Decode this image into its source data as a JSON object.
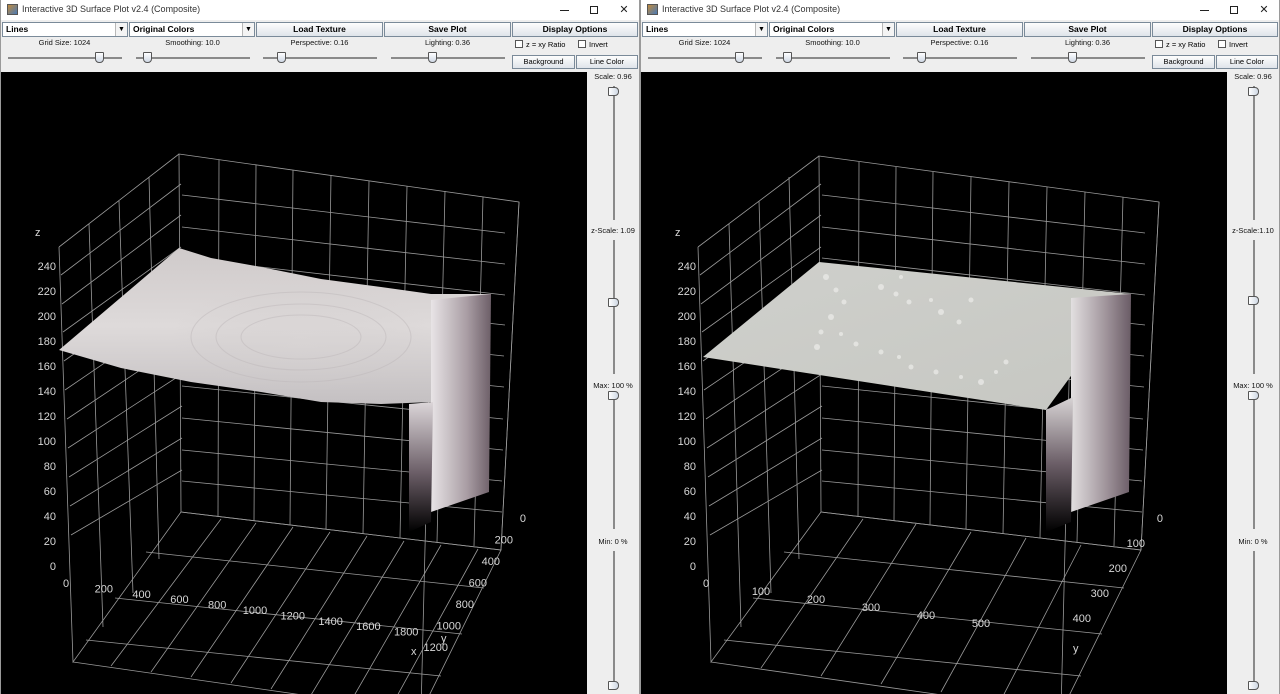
{
  "windows": [
    {
      "title": "Interactive 3D Surface Plot v2.4  (Composite)",
      "style_select": "Lines",
      "color_select": "Original Colors",
      "load_texture": "Load Texture",
      "save_plot": "Save Plot",
      "display_options": "Display Options",
      "grid_size": "Grid Size: 1024",
      "smoothing": "Smoothing: 10.0",
      "perspective": "Perspective: 0.16",
      "lighting": "Lighting: 0.36",
      "z_xy_ratio": "z = xy Ratio",
      "invert": "Invert",
      "background": "Background",
      "line_color": "Line Color",
      "scale": "Scale: 0.96",
      "z_scale": "z-Scale: 1.09",
      "max": "Max: 100 %",
      "min": "Min: 0 %",
      "axis_z": "z",
      "axis_x": "x",
      "axis_y": "y",
      "z_ticks": [
        "0",
        "20",
        "40",
        "60",
        "80",
        "100",
        "120",
        "140",
        "160",
        "180",
        "200",
        "220",
        "240"
      ],
      "x_ticks": [
        "0",
        "200",
        "400",
        "600",
        "800",
        "1000",
        "1200",
        "1400",
        "1600",
        "1800"
      ],
      "y_ticks": [
        "0",
        "200",
        "400",
        "600",
        "800",
        "1000",
        "1200"
      ],
      "sliders": {
        "grid_size": 0.8,
        "smoothing": 0.1,
        "perspective": 0.16,
        "lighting": 0.36
      },
      "vsliders": {
        "scale": 0.96,
        "z_scale": 0.54,
        "max": 1.0,
        "min": 0.0
      },
      "surface_shape": "dish"
    },
    {
      "title": "Interactive 3D Surface Plot v2.4  (Composite)",
      "style_select": "Lines",
      "color_select": "Original Colors",
      "load_texture": "Load Texture",
      "save_plot": "Save Plot",
      "display_options": "Display Options",
      "grid_size": "Grid Size: 1024",
      "smoothing": "Smoothing: 10.0",
      "perspective": "Perspective: 0.16",
      "lighting": "Lighting: 0.36",
      "z_xy_ratio": "z = xy Ratio",
      "invert": "Invert",
      "background": "Background",
      "line_color": "Line Color",
      "scale": "Scale: 0.96",
      "z_scale": "z-Scale:1.10",
      "max": "Max: 100 %",
      "min": "Min: 0 %",
      "axis_z": "z",
      "axis_x": "x",
      "axis_y": "y",
      "z_ticks": [
        "0",
        "20",
        "40",
        "60",
        "80",
        "100",
        "120",
        "140",
        "160",
        "180",
        "200",
        "220",
        "240"
      ],
      "x_ticks": [
        "0",
        "100",
        "200",
        "300",
        "400",
        "500"
      ],
      "y_ticks": [
        "0",
        "100",
        "200",
        "300",
        "400"
      ],
      "sliders": {
        "grid_size": 0.8,
        "smoothing": 0.1,
        "perspective": 0.16,
        "lighting": 0.36
      },
      "vsliders": {
        "scale": 0.96,
        "z_scale": 0.55,
        "max": 1.0,
        "min": 0.0
      },
      "surface_shape": "flat"
    }
  ],
  "colors": {
    "plot_background": "#000000",
    "grid_line": "#9a9a9a",
    "tick_text": "#d8d8d8",
    "surface_light": "#d9d6d6",
    "surface_dark": "#5a4e55",
    "chrome": "#eeeeee"
  }
}
